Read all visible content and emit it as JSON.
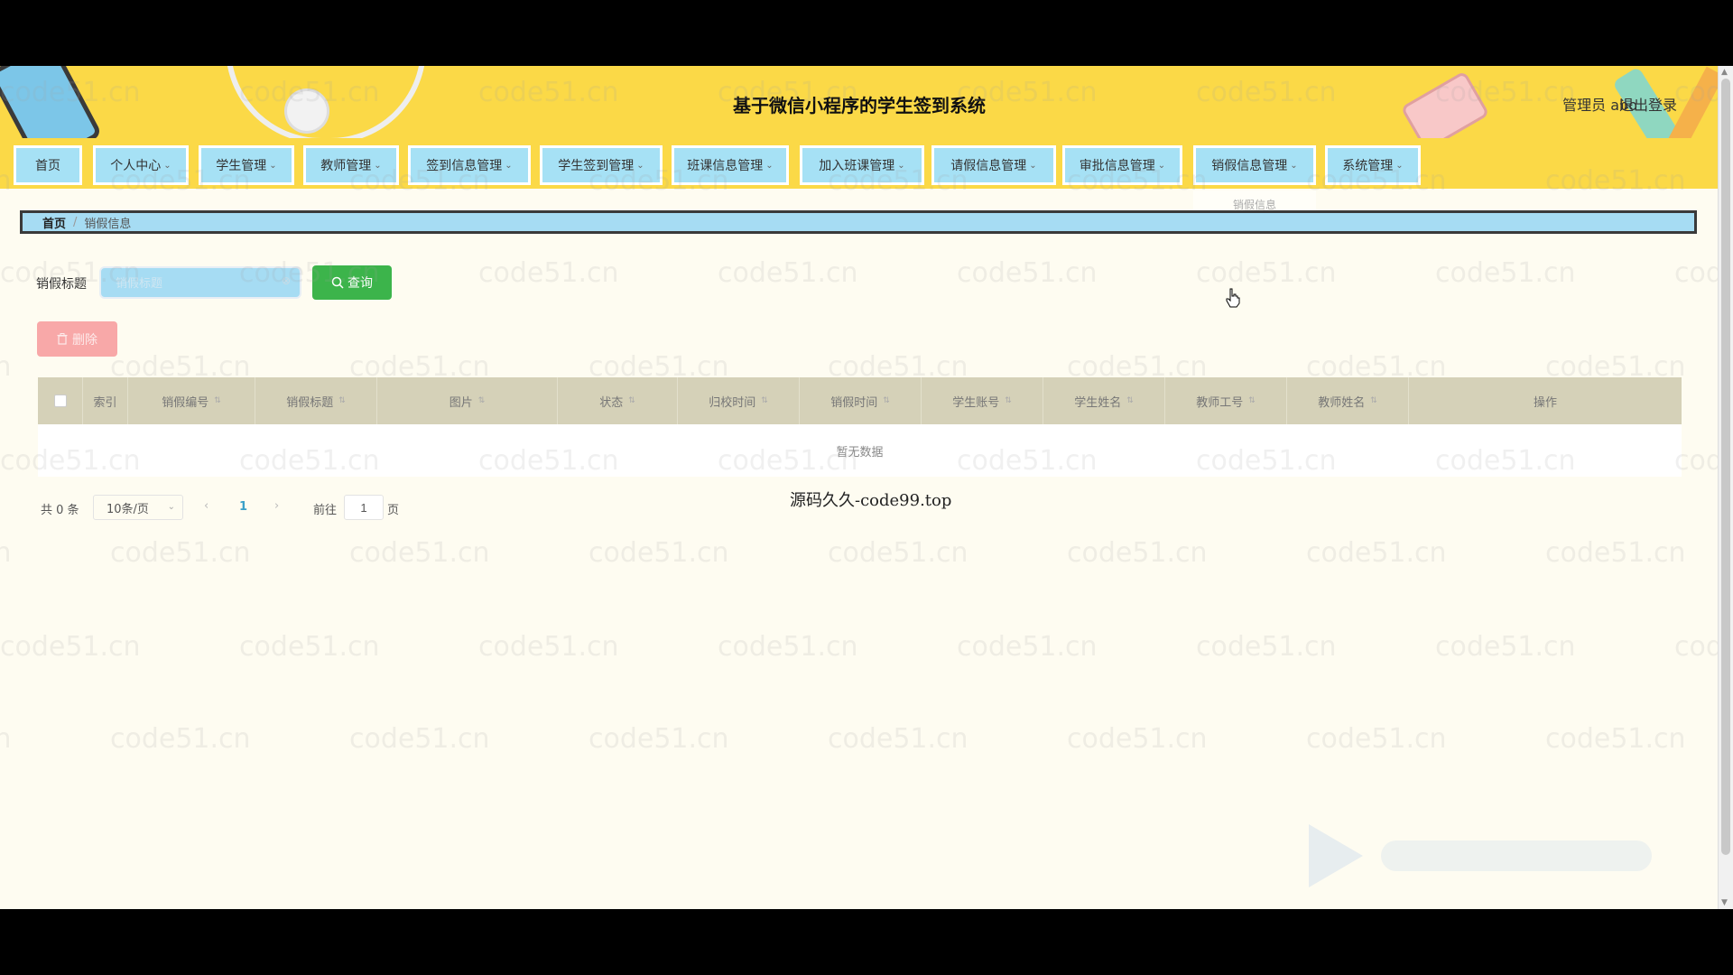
{
  "header": {
    "title": "基于微信小程序的学生签到系统",
    "user": "管理员 abo",
    "logout": "退出登录"
  },
  "nav": {
    "items": [
      {
        "label": "首页",
        "has_dropdown": false
      },
      {
        "label": "个人中心",
        "has_dropdown": true
      },
      {
        "label": "学生管理",
        "has_dropdown": true
      },
      {
        "label": "教师管理",
        "has_dropdown": true
      },
      {
        "label": "签到信息管理",
        "has_dropdown": true
      },
      {
        "label": "学生签到管理",
        "has_dropdown": true
      },
      {
        "label": "班课信息管理",
        "has_dropdown": true
      },
      {
        "label": "加入班课管理",
        "has_dropdown": true
      },
      {
        "label": "请假信息管理",
        "has_dropdown": true
      },
      {
        "label": "审批信息管理",
        "has_dropdown": true
      },
      {
        "label": "销假信息管理",
        "has_dropdown": true
      },
      {
        "label": "系统管理",
        "has_dropdown": true
      }
    ],
    "chevron": "⌄",
    "submenu_item": "销假信息"
  },
  "breadcrumb": {
    "home": "首页",
    "separator": "/",
    "current": "销假信息"
  },
  "search": {
    "label": "销假标题",
    "placeholder": "销假标题",
    "clear_icon": "⊗",
    "query_label": "查询",
    "query_icon": "search-icon"
  },
  "actions": {
    "delete_label": "删除",
    "delete_icon": "trash-icon"
  },
  "table": {
    "columns": [
      "索引",
      "销假编号",
      "销假标题",
      "图片",
      "状态",
      "归校时间",
      "销假时间",
      "学生账号",
      "学生姓名",
      "教师工号",
      "教师姓名",
      "操作"
    ],
    "sort_icon": "⇅",
    "empty_text": "暂无数据"
  },
  "pagination": {
    "total": "共 0 条",
    "page_size": "10条/页",
    "prev": "‹",
    "current_page": "1",
    "next": "›",
    "goto_label": "前往",
    "goto_value": "1",
    "page_suffix": "页"
  },
  "watermark": {
    "tile_text": "code51.cn",
    "footer_text": "源码久久-code99.top"
  },
  "colors": {
    "header_bg": "#fbd947",
    "nav_item_bg": "#a6e1f5",
    "page_bg": "#fefcf1",
    "query_button": "#3cb44b",
    "delete_button": "#f8a8a8",
    "table_header": "#d5d1b8"
  }
}
